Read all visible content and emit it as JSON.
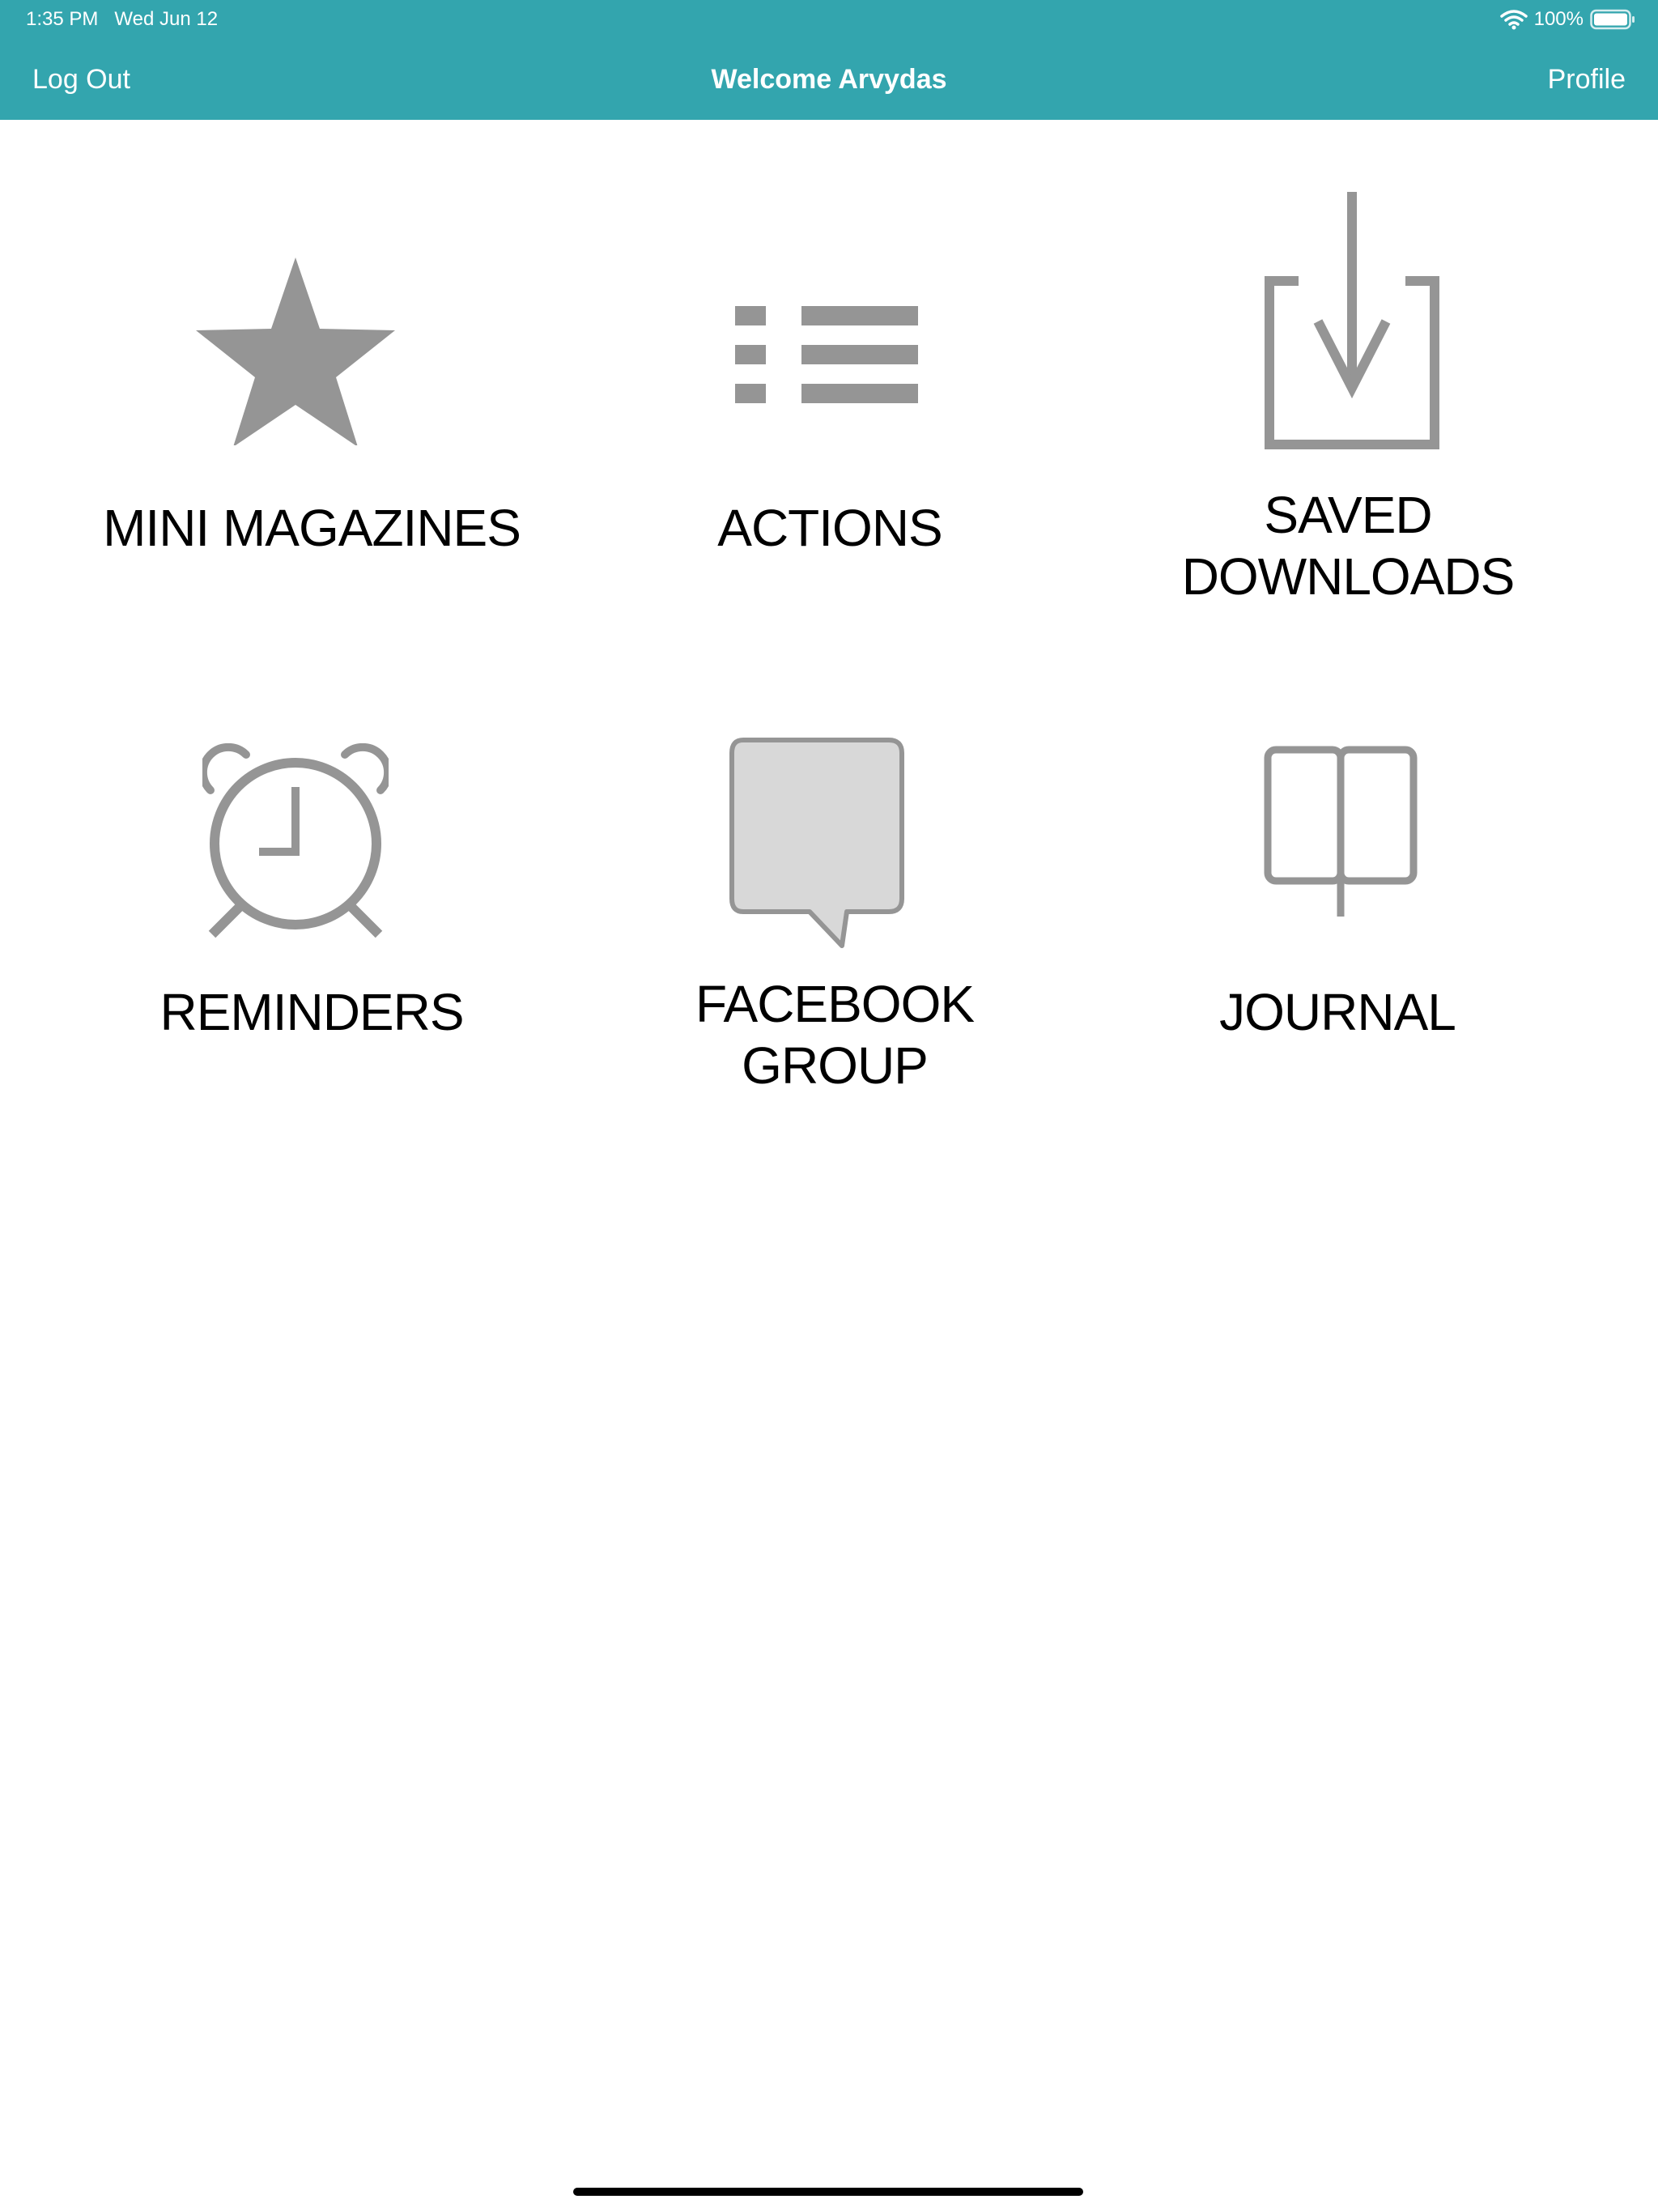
{
  "status_bar": {
    "time": "1:35 PM",
    "date": "Wed Jun 12",
    "battery_text": "100%",
    "icons": [
      "wifi-icon",
      "battery-icon"
    ]
  },
  "nav": {
    "left": "Log Out",
    "title": "Welcome Arvydas",
    "right": "Profile"
  },
  "tiles": [
    {
      "label": "MINI MAGAZINES",
      "icon": "star-icon"
    },
    {
      "label": "ACTIONS",
      "icon": "list-icon"
    },
    {
      "label": "SAVED\nDOWNLOADS",
      "icon": "download-icon"
    },
    {
      "label": "REMINDERS",
      "icon": "alarm-clock-icon"
    },
    {
      "label": "FACEBOOK\nGROUP",
      "icon": "chat-bubble-icon"
    },
    {
      "label": "JOURNAL",
      "icon": "book-icon"
    }
  ],
  "colors": {
    "header": "#33a5ae",
    "icon": "#959595",
    "bubble_fill": "#d8d8d8"
  }
}
